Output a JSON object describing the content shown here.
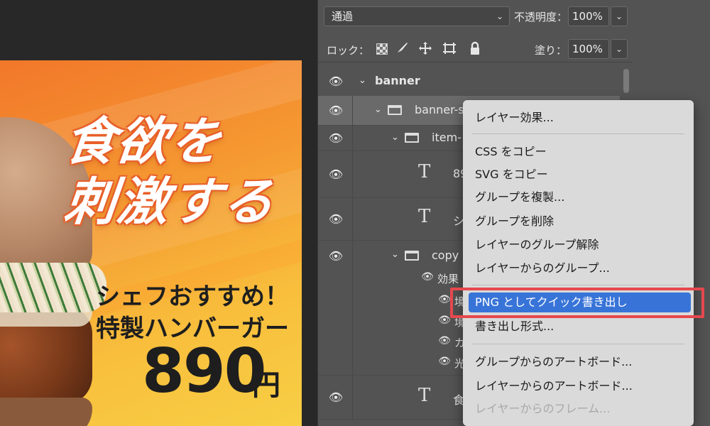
{
  "options_bar": {
    "blend_mode": "通過",
    "opacity_label": "不透明度：",
    "opacity_value": "100%",
    "lock_label": "ロック：",
    "fill_label": "塗り：",
    "fill_value": "100%"
  },
  "banner": {
    "headline_line1": "食欲を",
    "headline_line2": "刺激する",
    "sub_line1": "シェフおすすめ！",
    "sub_line2": "特製ハンバーガー",
    "price": "890",
    "currency": "円"
  },
  "layers": [
    {
      "name": "banner",
      "type": "group",
      "depth": 0
    },
    {
      "name": "banner-s",
      "type": "group",
      "depth": 1
    },
    {
      "name": "item-",
      "type": "group",
      "depth": 2
    },
    {
      "name": "89",
      "type": "text",
      "depth": 3
    },
    {
      "name": "シ",
      "type": "text",
      "depth": 3
    },
    {
      "name": "copy",
      "type": "group",
      "depth": 2
    },
    {
      "name": "効果",
      "type": "effects",
      "depth": 3
    },
    {
      "name": "境",
      "type": "effect",
      "depth": 4
    },
    {
      "name": "境",
      "type": "effect",
      "depth": 4
    },
    {
      "name": "カ",
      "type": "effect",
      "depth": 4
    },
    {
      "name": "光",
      "type": "effect",
      "depth": 4
    },
    {
      "name": "食",
      "type": "text",
      "depth": 2
    }
  ],
  "context_menu": {
    "items": [
      {
        "label": "レイヤー効果..."
      },
      {
        "label": "CSS をコピー"
      },
      {
        "label": "SVG をコピー"
      },
      {
        "label": "グループを複製..."
      },
      {
        "label": "グループを削除"
      },
      {
        "label": "レイヤーのグループ解除"
      },
      {
        "label": "レイヤーからのグループ..."
      },
      {
        "label": "PNG としてクイック書き出し",
        "highlighted": true
      },
      {
        "label": "書き出し形式..."
      },
      {
        "label": "グループからのアートボード..."
      },
      {
        "label": "レイヤーからのアートボード..."
      },
      {
        "label": "レイヤーからのフレーム...",
        "disabled": true
      }
    ]
  },
  "colors": {
    "panel_bg": "#535353",
    "menu_bg": "#dadada",
    "highlight": "#3874d8",
    "annotation_box": "#e5484d"
  }
}
